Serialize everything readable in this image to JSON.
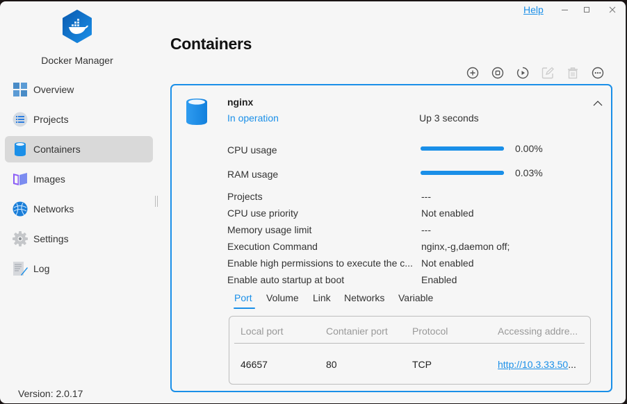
{
  "app": {
    "name": "Docker Manager",
    "version": "Version: 2.0.17"
  },
  "titlebar": {
    "help": "Help",
    "minimize_icon": "minimize-icon",
    "maximize_icon": "maximize-icon",
    "close_icon": "close-icon"
  },
  "sidebar": {
    "items": [
      {
        "label": "Overview",
        "icon": "overview-grid-icon",
        "active": false
      },
      {
        "label": "Projects",
        "icon": "projects-list-icon",
        "active": false
      },
      {
        "label": "Containers",
        "icon": "container-cylinder-icon",
        "active": true
      },
      {
        "label": "Images",
        "icon": "images-book-icon",
        "active": false
      },
      {
        "label": "Networks",
        "icon": "networks-globe-icon",
        "active": false
      },
      {
        "label": "Settings",
        "icon": "settings-gear-icon",
        "active": false
      },
      {
        "label": "Log",
        "icon": "log-document-icon",
        "active": false
      }
    ]
  },
  "main": {
    "title": "Containers",
    "toolbar": [
      {
        "name": "add",
        "icon": "plus-circle-icon",
        "enabled": true
      },
      {
        "name": "stop",
        "icon": "stop-circle-icon",
        "enabled": true
      },
      {
        "name": "restart",
        "icon": "restart-play-icon",
        "enabled": true
      },
      {
        "name": "edit",
        "icon": "edit-icon",
        "enabled": false
      },
      {
        "name": "delete",
        "icon": "trash-icon",
        "enabled": false
      },
      {
        "name": "more",
        "icon": "more-ellipsis-icon",
        "enabled": true
      }
    ],
    "container": {
      "name": "nginx",
      "status": "In operation",
      "uptime": "Up 3 seconds",
      "cpu": {
        "label": "CPU usage",
        "value": "0.00%",
        "bar_fill_percent": 100
      },
      "ram": {
        "label": "RAM usage",
        "value": "0.03%",
        "bar_fill_percent": 100
      },
      "details": [
        {
          "label": "Projects",
          "value": "---"
        },
        {
          "label": "CPU use priority",
          "value": "Not enabled"
        },
        {
          "label": "Memory usage limit",
          "value": "---"
        },
        {
          "label": "Execution Command",
          "value": "nginx,-g,daemon off;"
        },
        {
          "label": "Enable high permissions to execute the c...",
          "value": "Not enabled"
        },
        {
          "label": "Enable auto startup at boot",
          "value": "Enabled"
        }
      ],
      "tabs": [
        {
          "label": "Port",
          "active": true
        },
        {
          "label": "Volume",
          "active": false
        },
        {
          "label": "Link",
          "active": false
        },
        {
          "label": "Networks",
          "active": false
        },
        {
          "label": "Variable",
          "active": false
        }
      ],
      "ports": {
        "headers": [
          "Local port",
          "Contanier port",
          "Protocol",
          "Accessing addre..."
        ],
        "rows": [
          {
            "local": "46657",
            "container": "80",
            "protocol": "TCP",
            "address": "http://10.3.33.50",
            "address_ellipsis": "..."
          }
        ]
      }
    }
  },
  "colors": {
    "accent": "#1a8fe8",
    "active_nav_bg": "#d9d9d9",
    "background": "#f6f6f6"
  }
}
